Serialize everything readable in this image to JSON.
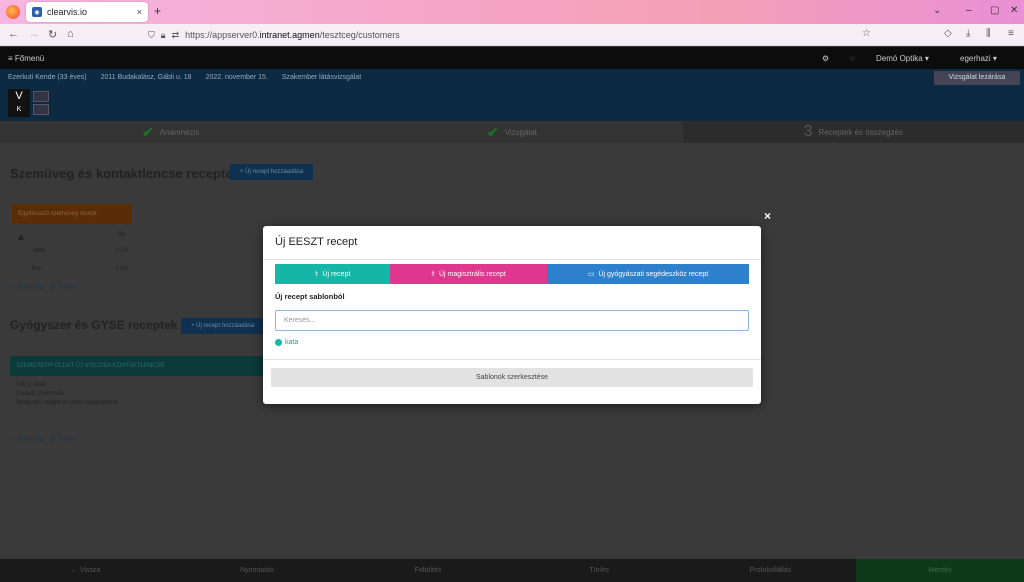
{
  "browser": {
    "tab_title": "clearvis.io",
    "tab_close": "×",
    "new_tab": "+",
    "url_prefix": "https://appserver0.",
    "url_domain": "intranet.agmen",
    "url_path": "/tesztceg/customers"
  },
  "app": {
    "menu_label": "≡ Főmenü",
    "nav_right": [
      "Demó Optika ▾",
      "egerhazi ▾"
    ],
    "patient_info": [
      "Ezerkuti Kende (33 éves)",
      "2011 Budakalász, Gábli u. 18",
      "2022. november 15.",
      "Szakember látásvizsgálat"
    ],
    "badge_letters": [
      "V",
      "K"
    ],
    "close_exam_label": "Vizsgálat lezárása",
    "steps": [
      {
        "label": "Anamnézis",
        "mark": "✔"
      },
      {
        "label": "Vizsgálat",
        "mark": "✔"
      },
      {
        "label": "Receptek és összegzés",
        "mark": "3"
      }
    ],
    "section1_title": "Szemüveg és kontaktlencse receptek",
    "section1_button": "+ Új recept hozzáadása",
    "orange_label": "Egyfókuszú szemüveg recept",
    "rx_header": "Sp",
    "rx_rows": [
      [
        "Jobb",
        "-1.25"
      ],
      [
        "Bal",
        "-1.50"
      ]
    ],
    "edit_link": "✎ Módosítás",
    "delete_link": "🗑 Törlés",
    "section2_title": "Gyógyszer és GYSE receptek",
    "section2_button": "+ Új recept hozzáadása",
    "drug_label": "SZEMCSEPP OLDAT ÚJ VISCOSA KONTAKTLENCSE",
    "drug_lines": [
      "100 g oldat",
      "1 tubus, Normaita",
      "Adagolás: reggel és este cseppenként"
    ],
    "footer": [
      "← Vissza",
      "Nyomtatás",
      "Feltöltés",
      "Törlés",
      "Protokollállás",
      "Mentés"
    ]
  },
  "modal": {
    "close": "×",
    "title": "Új EESZT recept",
    "buttons": [
      {
        "icon": "pills-icon",
        "label": "Új recept"
      },
      {
        "icon": "pills-icon",
        "label": "Új magisztrális recept"
      },
      {
        "icon": "id-card-icon",
        "label": "Új gyógyászati segédeszköz recept"
      }
    ],
    "subtitle": "Új recept sablonból",
    "search_placeholder": "Keresés...",
    "template_name": "kata",
    "edit_templates_label": "Sablonok szerkesztése"
  },
  "colors": {
    "teal": "#15b5a8",
    "pink": "#e0378e",
    "blue": "#2c80cc"
  }
}
